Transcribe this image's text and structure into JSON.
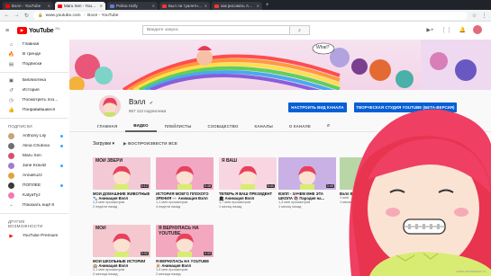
{
  "browser": {
    "tabs": [
      {
        "title": "Вэлл - YouTube",
        "color": "#ff0000",
        "active": false
      },
      {
        "title": "Maru Xen - YouTube",
        "color": "#ff0000",
        "active": true
      },
      {
        "title": "Polina Holly",
        "color": "#5b7fd1",
        "active": false
      },
      {
        "title": "Был ли туалетная — Янд",
        "color": "#ff3333",
        "active": false
      },
      {
        "title": "как рисовать Анимация —",
        "color": "#ff3333",
        "active": false
      }
    ],
    "new_tab": "+",
    "address": "www.youtube.com",
    "page_title": "Вэлл - YouTube"
  },
  "header": {
    "logo_text": "YouTube",
    "logo_region": "RU",
    "search_placeholder": "Введите запрос"
  },
  "sidebar": {
    "main": [
      {
        "icon": "home-icon",
        "glyph": "⌂",
        "label": "Главная"
      },
      {
        "icon": "trending-icon",
        "glyph": "🔥",
        "label": "В тренде"
      },
      {
        "icon": "subscriptions-icon",
        "glyph": "▤",
        "label": "Подписки"
      }
    ],
    "library": [
      {
        "icon": "library-icon",
        "glyph": "▣",
        "label": "Библиотека"
      },
      {
        "icon": "history-icon",
        "glyph": "↺",
        "label": "История"
      },
      {
        "icon": "watch-later-icon",
        "glyph": "◷",
        "label": "Посмотреть поз..."
      },
      {
        "icon": "liked-icon",
        "glyph": "👍",
        "label": "Понравившиеся"
      }
    ],
    "subs_title": "ПОДПИСКИ",
    "subs": [
      {
        "label": "Anthony Lily",
        "color": "#c9a27a",
        "dot": true
      },
      {
        "label": "Alina Chutova",
        "color": "#6f6f6f",
        "dot": true
      },
      {
        "label": "Maru Xen",
        "color": "#d94f6a",
        "dot": false
      },
      {
        "label": "Jane Kravitz",
        "color": "#a17ccf",
        "dot": true
      },
      {
        "label": "AnnaKuzz",
        "color": "#e0a43d",
        "dot": false
      },
      {
        "label": "ПОПЛЕЕ",
        "color": "#3a3a3a",
        "dot": true
      },
      {
        "label": "KatyaTyz",
        "color": "#f07bb0",
        "dot": false
      },
      {
        "label": "Показать ещё 8",
        "color": "",
        "dot": false
      }
    ],
    "other_title": "ДРУГИЕ ВОЗМОЖНОСТИ",
    "other": [
      {
        "label": "YouTube Premium"
      }
    ]
  },
  "channel": {
    "name": "Вэлл",
    "verified": "✔",
    "subscribers": "857 113 подписчика",
    "btn_customize": "НАСТРОИТЬ ВИД КАНАЛА",
    "btn_studio": "ТВОРЧЕСКАЯ СТУДИЯ YOUTUBE (БЕТА-ВЕРСИЯ)",
    "tabs": [
      "ГЛАВНАЯ",
      "ВИДЕО",
      "ПЛЕЙЛИСТЫ",
      "СООБЩЕСТВО",
      "КАНАЛЫ",
      "О КАНАЛЕ"
    ],
    "active_tab": 1,
    "banner_text": "What?"
  },
  "videos": {
    "section_title": "Загрузки",
    "play_all": "ВОСПРОИЗВЕСТИ ВСЕ",
    "items": [
      {
        "title": "МОИ ДОМАШНИЕ ЖИВОТНЫЕ 🐾 Анимация Вэлл",
        "views": "1,4 млн просмотров",
        "age": "2 недели назад",
        "duration": "6:12",
        "bg": "#f3c9d6",
        "label": "МОИ ЗВЕРИ"
      },
      {
        "title": "ИСТОРИЯ МОЕГО ПЛОХОГО ЗРЕНИЯ 👓 Анимация Вэлл",
        "views": "1,1 млн просмотров",
        "age": "4 недели назад",
        "duration": "5:48",
        "bg": "#f1a9c3",
        "label": ""
      },
      {
        "title": "ТЕПЕРЬ Я ВАШ ПРЕЗИДЕНТ 🏛 Анимация Вэлл",
        "views": "1,7 млн просмотров",
        "age": "1 месяц назад",
        "duration": "5:41",
        "bg": "#f7d6e2",
        "label": "Я ВАШ"
      },
      {
        "title": "ВЭЛЛ - ЗАЧЕМ МНЕ ЭТА ШКОЛА 📚 Пародия на...",
        "views": "1,3 млн просмотров",
        "age": "1 месяц назад",
        "duration": "3:49",
        "bg": "#c9b1e6",
        "label": ""
      },
      {
        "title": "Вэлл Вэлл Вэлл",
        "views": "1 млн",
        "age": "1 месяц",
        "duration": "4:10",
        "bg": "#b9d7a6",
        "label": ""
      },
      {
        "title": "МОИ ШКОЛЬНЫЕ ИСТОРИИ 🏫 Анимация Вэлл",
        "views": "2,1 млн просмотров",
        "age": "2 месяца назад",
        "duration": "5:02",
        "bg": "#f5c7cf",
        "label": "МОИ"
      },
      {
        "title": "Я ВЕРНУЛАСЬ НА YOUTUBE 🎉 Анимация Вэлл",
        "views": "1,9 млн просмотров",
        "age": "2 месяца назад",
        "duration": "4:33",
        "bg": "#f3a8bf",
        "label": "Я ВЕРНУЛАСЬ НА YOUTUBE"
      }
    ]
  },
  "watermark": "www.imbalance.ru"
}
